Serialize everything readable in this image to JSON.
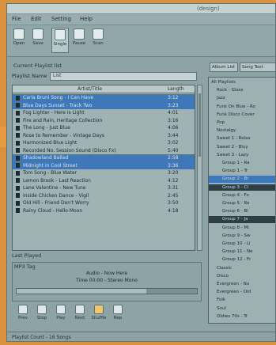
{
  "window": {
    "title": "(design)"
  },
  "menu": [
    {
      "label": "File"
    },
    {
      "label": "Edit"
    },
    {
      "label": "Setting"
    },
    {
      "label": "Help"
    }
  ],
  "toolbar": [
    {
      "label": "Open",
      "icon": "open-icon"
    },
    {
      "label": "Save",
      "icon": "save-icon"
    },
    {
      "label": "Single",
      "icon": "single-icon"
    },
    {
      "label": "Pause",
      "icon": "pause-icon"
    },
    {
      "label": "Scan",
      "icon": "scan-icon"
    }
  ],
  "left": {
    "playlist_label": "Current Playlist list",
    "find_label": "Playlist Name",
    "find_value": "List",
    "columns": {
      "title": "Artist/Title",
      "length": "Length"
    },
    "rows": [
      {
        "title": "Carla Bruni Song - I Can Have",
        "length": "3:12",
        "selected": true
      },
      {
        "title": "Blue Days Sunset - Track Two",
        "length": "3:23",
        "selected": true
      },
      {
        "title": "Fog Lighter - Here is Light",
        "length": "4:01",
        "selected": false
      },
      {
        "title": "Fire and Rain, Heritage Collection",
        "length": "3:16",
        "selected": false
      },
      {
        "title": "The Long - Just Blue",
        "length": "4:06",
        "selected": false
      },
      {
        "title": "Rose to Remember - Vintage Days",
        "length": "3:44",
        "selected": false
      },
      {
        "title": "Harmonized Blue Light",
        "length": "3:02",
        "selected": false
      },
      {
        "title": "Recorded No. Session Sound (Disco Fx)",
        "length": "5:40",
        "selected": false
      },
      {
        "title": "Shadowland Ballad",
        "length": "2:58",
        "selected": true
      },
      {
        "title": "Midnight in Cool Street",
        "length": "3:36",
        "selected": true
      },
      {
        "title": "Tom Song - Blue Water",
        "length": "3:20",
        "selected": false
      },
      {
        "title": "Lemon Brook - Last Reaction",
        "length": "4:12",
        "selected": false
      },
      {
        "title": "Lane Valentine - New Tune",
        "length": "3:31",
        "selected": false
      },
      {
        "title": "Inside Chicken Dance - Vigil",
        "length": "2:45",
        "selected": false
      },
      {
        "title": "Old Hill - Friend Don't Worry",
        "length": "3:50",
        "selected": false
      },
      {
        "title": "Rainy Cloud - Hello Moon",
        "length": "4:18",
        "selected": false
      }
    ],
    "mp3_section": "MP3 Tag",
    "now_title": "Audio - Now Here",
    "now_time": "Time 00:00 - Stereo Mono",
    "seek_progress": 0.72,
    "bottom_label": "Last Played"
  },
  "controls": [
    {
      "label": "Prev",
      "icon": "prev-icon"
    },
    {
      "label": "Stop",
      "icon": "stop-icon"
    },
    {
      "label": "Play",
      "icon": "play-icon"
    },
    {
      "label": "Next",
      "icon": "next-icon"
    },
    {
      "label": "Shuffle",
      "icon": "shuffle-icon",
      "highlight": true
    },
    {
      "label": "Rep",
      "icon": "repeat-icon"
    }
  ],
  "status": "Playlist Count - 16 Songs",
  "right": {
    "tabs": [
      "Album List",
      "Song Text"
    ],
    "tree": [
      {
        "text": "All Playlists",
        "indent": 0
      },
      {
        "text": "Rock - Glass",
        "indent": 1
      },
      {
        "text": "Jazz",
        "indent": 1
      },
      {
        "text": "Funk On Blue - Ro",
        "indent": 1
      },
      {
        "text": "Funk Disco Cover",
        "indent": 1
      },
      {
        "text": "Pop",
        "indent": 1
      },
      {
        "text": "Nostalgy",
        "indent": 1
      },
      {
        "text": "Sweet 1 - Relax",
        "indent": 1
      },
      {
        "text": "Sweet 2 - Bluy",
        "indent": 1
      },
      {
        "text": "Sweet 3 - Lazy",
        "indent": 1
      },
      {
        "text": "Group 1 - Ra",
        "indent": 2
      },
      {
        "text": "Group 1 - Tr",
        "indent": 2
      },
      {
        "text": "Group 2 - Br",
        "indent": 2,
        "state": "sel"
      },
      {
        "text": "Group 3 - Cl",
        "indent": 2,
        "state": "dark"
      },
      {
        "text": "Group 4 - Fo",
        "indent": 2
      },
      {
        "text": "Group 5 - Ro",
        "indent": 2
      },
      {
        "text": "Group 6 - Bl",
        "indent": 2
      },
      {
        "text": "Group 7 - Ja",
        "indent": 2,
        "state": "dark"
      },
      {
        "text": "Group 8 - Mi",
        "indent": 2
      },
      {
        "text": "Group 9 - Sw",
        "indent": 2
      },
      {
        "text": "Group 10 - Li",
        "indent": 2
      },
      {
        "text": "Group 11 - Ne",
        "indent": 2
      },
      {
        "text": "Group 12 - Fr",
        "indent": 2
      },
      {
        "text": "Classic",
        "indent": 1
      },
      {
        "text": "Disco",
        "indent": 1
      },
      {
        "text": "Evergreen - Nu",
        "indent": 1
      },
      {
        "text": "Evergreen - Old",
        "indent": 1
      },
      {
        "text": "Folk",
        "indent": 1
      },
      {
        "text": "Soul",
        "indent": 1
      },
      {
        "text": "Oldies 70s - Tr",
        "indent": 1
      }
    ]
  }
}
